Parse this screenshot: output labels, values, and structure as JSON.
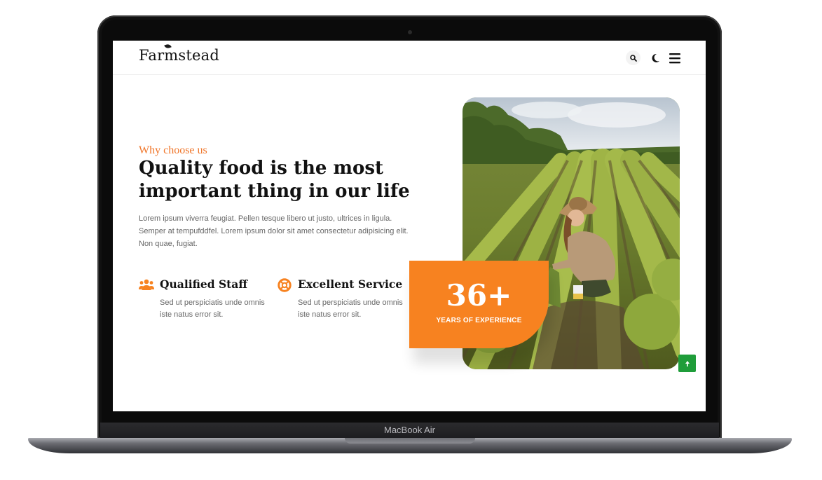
{
  "device": {
    "label": "MacBook Air"
  },
  "header": {
    "logo": "Farmstead",
    "icons": {
      "search": "search-icon",
      "theme": "moon-icon",
      "menu": "hamburger-menu-icon"
    }
  },
  "hero": {
    "eyebrow": "Why choose us",
    "title": "Quality food is the most important thing in our life",
    "lead": "Lorem ipsum viverra feugiat. Pellen tesque libero ut justo, ultrices in ligula. Semper at tempufddfel. Lorem ipsum dolor sit amet consectetur adipisicing elit. Non quae, fugiat."
  },
  "features": [
    {
      "icon": "users-icon",
      "title": "Qualified Staff",
      "text": "Sed ut perspiciatis unde omnis iste natus error sit."
    },
    {
      "icon": "lifebuoy-icon",
      "title": "Excellent Service",
      "text": "Sed ut perspiciatis unde omnis iste natus error sit."
    }
  ],
  "experience": {
    "number": "36+",
    "label": "YEARS OF EXPERIENCE"
  },
  "colors": {
    "accent": "#f78220",
    "eyebrow": "#f0762a",
    "scroll_top": "#1f9d3a",
    "text": "#111111",
    "muted": "#666666"
  }
}
